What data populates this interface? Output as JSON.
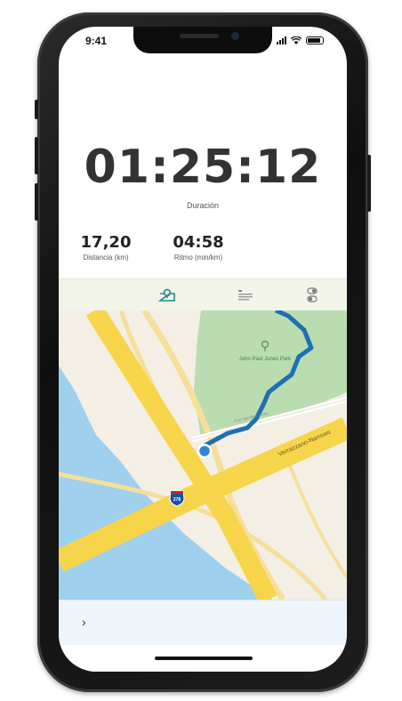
{
  "status_bar": {
    "time": "9:41"
  },
  "workout": {
    "duration": "01:25:12",
    "duration_label": "Duración",
    "distance": {
      "value": "17,20",
      "label": "Distancia (km)"
    },
    "pace": {
      "value": "04:58",
      "label": "Ritmo (min/km)"
    }
  },
  "tabs": [
    {
      "icon": "map-pin-tab-icon",
      "active": true
    },
    {
      "icon": "list-tab-icon",
      "active": false
    },
    {
      "icon": "stats-tab-icon",
      "active": false
    }
  ],
  "map": {
    "park_name": "John Paul Jones Park",
    "highway_label": "Verrazzano-Narrows",
    "interstate_shield": "278",
    "street_label": "Fort Hamilton Pkwy",
    "colors": {
      "route": "#1f6fb3",
      "park": "#b9dcb0",
      "water": "#9fd0ee",
      "land": "#f3efe4",
      "highway": "#f6d54b",
      "road": "#f5df9a",
      "location_dot": "#2f86d6"
    }
  },
  "bottom_bar": {
    "icon": "chevron-right-icon"
  },
  "accent_color": "#1f8a8f"
}
